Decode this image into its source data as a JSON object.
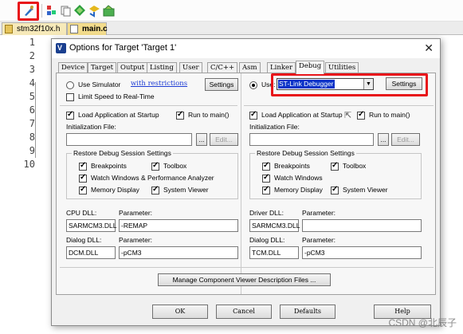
{
  "ide": {
    "file_tabs": [
      "stm32f10x.h",
      "main.c"
    ],
    "line_numbers": [
      "1",
      "2",
      "3",
      "4",
      "5",
      "6",
      "7",
      "8",
      "9",
      "10"
    ]
  },
  "dialog": {
    "title": "Options for Target 'Target 1'",
    "tabs": [
      "Device",
      "Target",
      "Output",
      "Listing",
      "User",
      "C/C++",
      "Asm",
      "Linker",
      "Debug",
      "Utilities"
    ],
    "active_tab": "Debug",
    "left": {
      "use_simulator_label": "Use Simulator",
      "restrictions_link": "with restrictions",
      "settings_label": "Settings",
      "limit_speed_label": "Limit Speed to Real-Time",
      "load_app_label": "Load Application at Startup",
      "run_to_main_label": "Run to main()",
      "init_file_label": "Initialization File:",
      "browse_label": "...",
      "edit_label": "Edit...",
      "restore_group_title": "Restore Debug Session Settings",
      "breakpoints_label": "Breakpoints",
      "toolbox_label": "Toolbox",
      "watch_label": "Watch Windows & Performance Analyzer",
      "memory_label": "Memory Display",
      "system_viewer_label": "System Viewer",
      "dll_label": "CPU DLL:",
      "param_label": "Parameter:",
      "dll_value": "SARMCM3.DLL",
      "param_value": "-REMAP",
      "dialog_dll_label": "Dialog DLL:",
      "dialog_param_label": "Parameter:",
      "dialog_dll_value": "DCM.DLL",
      "dialog_param_value": "-pCM3"
    },
    "right": {
      "use_label": "Use:",
      "debugger_value": "ST-Link Debugger",
      "settings_label": "Settings",
      "load_app_label": "Load Application at Startup",
      "run_to_main_label": "Run to main()",
      "init_file_label": "Initialization File:",
      "browse_label": "...",
      "edit_label": "Edit...",
      "restore_group_title": "Restore Debug Session Settings",
      "breakpoints_label": "Breakpoints",
      "toolbox_label": "Toolbox",
      "watch_label": "Watch Windows",
      "memory_label": "Memory Display",
      "system_viewer_label": "System Viewer",
      "dll_label": "Driver DLL:",
      "param_label": "Parameter:",
      "dll_value": "SARMCM3.DLL",
      "param_value": "",
      "dialog_dll_label": "Dialog DLL:",
      "dialog_param_label": "Parameter:",
      "dialog_dll_value": "TCM.DLL",
      "dialog_param_value": "-pCM3"
    },
    "manage_label": "Manage Component Viewer Description Files ...",
    "ok_label": "OK",
    "cancel_label": "Cancel",
    "defaults_label": "Defaults",
    "help_label": "Help"
  },
  "watermark": "CSDN @北辰子",
  "colors": {
    "highlight_box": "#e8141a",
    "selection": "#0a33c8"
  }
}
